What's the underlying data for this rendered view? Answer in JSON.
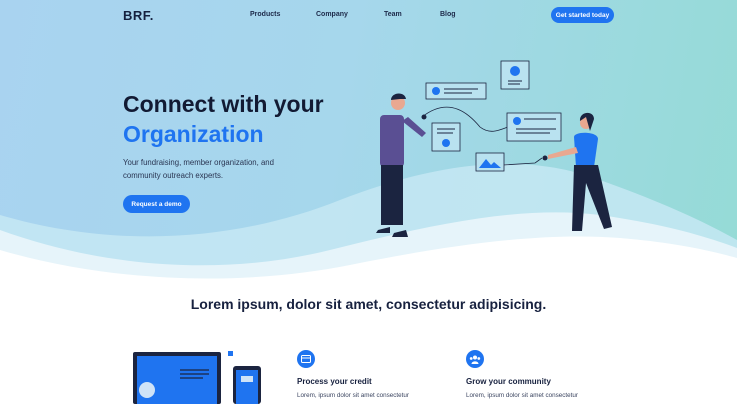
{
  "nav": {
    "logo": "BRF.",
    "links": [
      "Products",
      "Company",
      "Team",
      "Blog"
    ],
    "cta": "Get started today"
  },
  "hero": {
    "title_line1": "Connect with your",
    "title_line2": "Organization",
    "subtitle": "Your fundraising, member organization, and community outreach experts.",
    "button": "Request a demo"
  },
  "section": {
    "title": "Lorem ipsum, dolor sit amet, consectetur adipisicing."
  },
  "features": [
    {
      "icon": "credit-card-icon",
      "title": "Process your credit",
      "text": "Lorem, ipsum dolor sit amet consectetur"
    },
    {
      "icon": "community-icon",
      "title": "Grow your community",
      "text": "Lorem, ipsum dolor sit amet consectetur"
    }
  ],
  "colors": {
    "accent": "#1f74f0",
    "dark_text": "#121a33",
    "hero_gradient_start": "#a9d3f0",
    "hero_gradient_end": "#95dbd6"
  }
}
